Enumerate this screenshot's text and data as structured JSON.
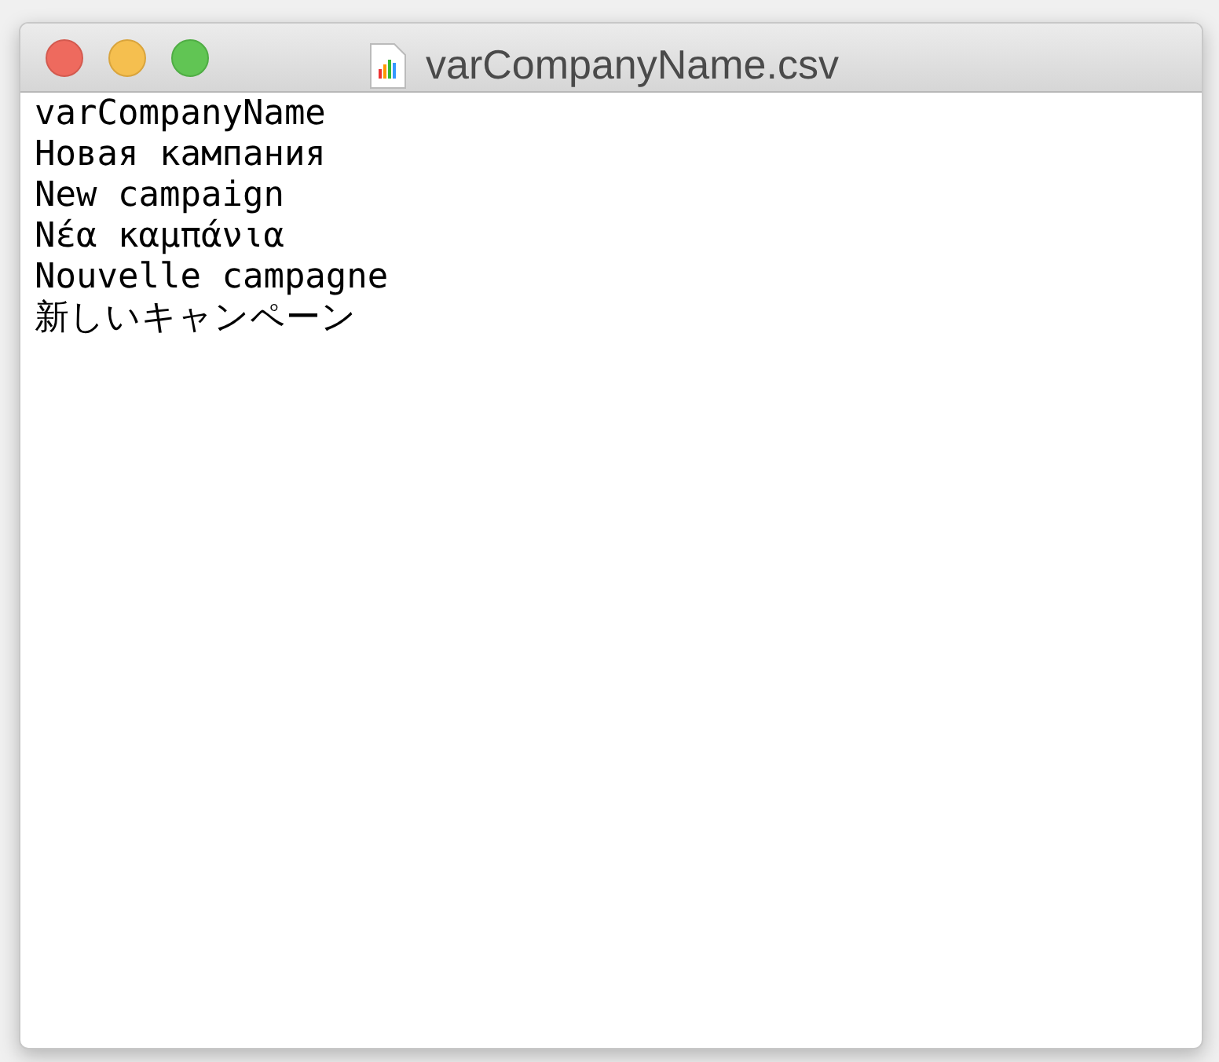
{
  "window": {
    "title": "varCompanyName.csv"
  },
  "lines": [
    "varCompanyName",
    "Новая кампания",
    "New campaign",
    "Νέα καμπάνια",
    "Nouvelle campagne",
    "新しいキャンペーン"
  ]
}
